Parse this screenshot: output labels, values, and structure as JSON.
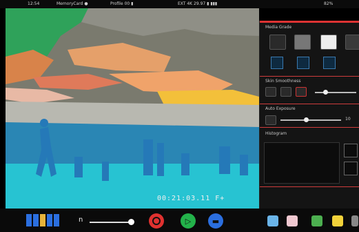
{
  "topbar": {
    "left": "12:54",
    "status_a": "MemoryCard ●",
    "status_b": "Profile 00 ▮",
    "status_c": "EXT 4K 29.97 ▮ ▮▮▮",
    "battery": "82%"
  },
  "timecode": "00:21:03.11 F+",
  "panel": {
    "section1": "Media Grade",
    "section2": "Skin Smoothness",
    "section3": "Auto Exposure",
    "section4": "Histogram",
    "slider_value": "10"
  },
  "bottom": {
    "n_label": "n",
    "colors": {
      "record": "#e0312f",
      "play": "#23b24a",
      "stop": "#2b6fe0"
    }
  }
}
